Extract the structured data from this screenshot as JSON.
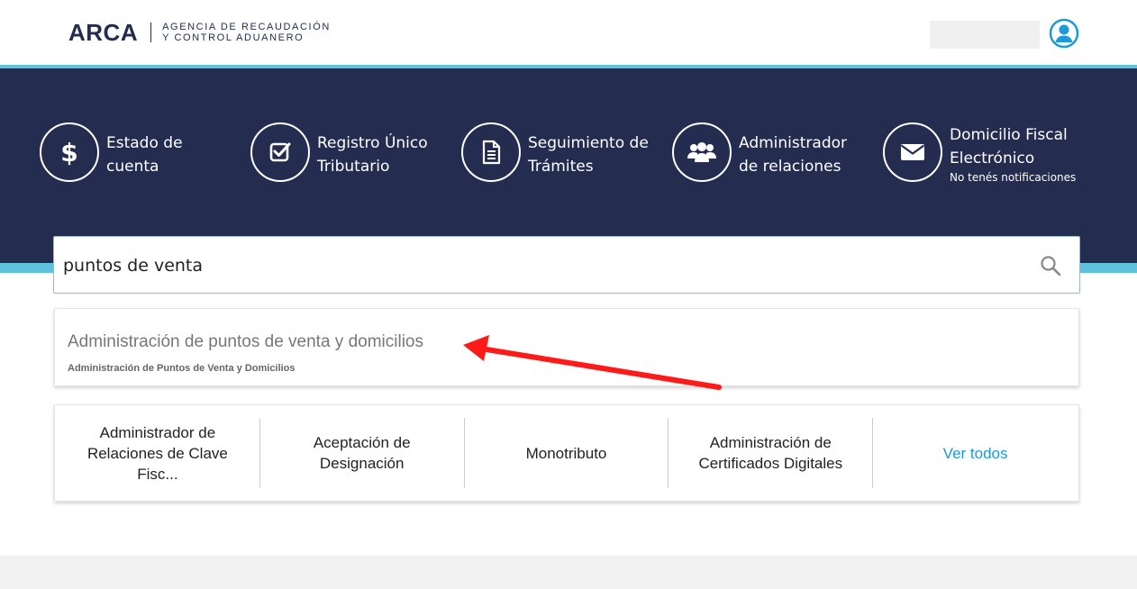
{
  "header": {
    "logo": "ARCA",
    "logo_subtitle_line1": "AGENCIA DE RECAUDACIÓN",
    "logo_subtitle_line2": "Y CONTROL ADUANERO",
    "user_icon": "user-circle-icon"
  },
  "quick_links": [
    {
      "icon": "dollar-icon",
      "label": "Estado de cuenta"
    },
    {
      "icon": "checkbox-icon",
      "label": "Registro Único Tributario"
    },
    {
      "icon": "document-icon",
      "label": "Seguimiento de Trámites"
    },
    {
      "icon": "users-icon",
      "label": "Administrador de relaciones"
    },
    {
      "icon": "envelope-icon",
      "label": "Domicilio Fiscal Electrónico",
      "note": "No tenés notificaciones"
    }
  ],
  "search": {
    "value": "puntos de venta",
    "icon": "search-icon"
  },
  "suggestion": {
    "title": "Administración de puntos de venta y domicilios",
    "subtitle": "Administración de Puntos de Venta y Domicilios"
  },
  "shortcuts": [
    "Administrador de Relaciones de Clave Fisc...",
    "Aceptación de Designación",
    "Monotributo",
    "Administración de Certificados Digitales",
    "Ver todos"
  ],
  "colors": {
    "navy": "#242c4f",
    "cyan": "#5fc3de",
    "link": "#1a9ad6",
    "annotation_arrow": "#ff1a1a"
  }
}
